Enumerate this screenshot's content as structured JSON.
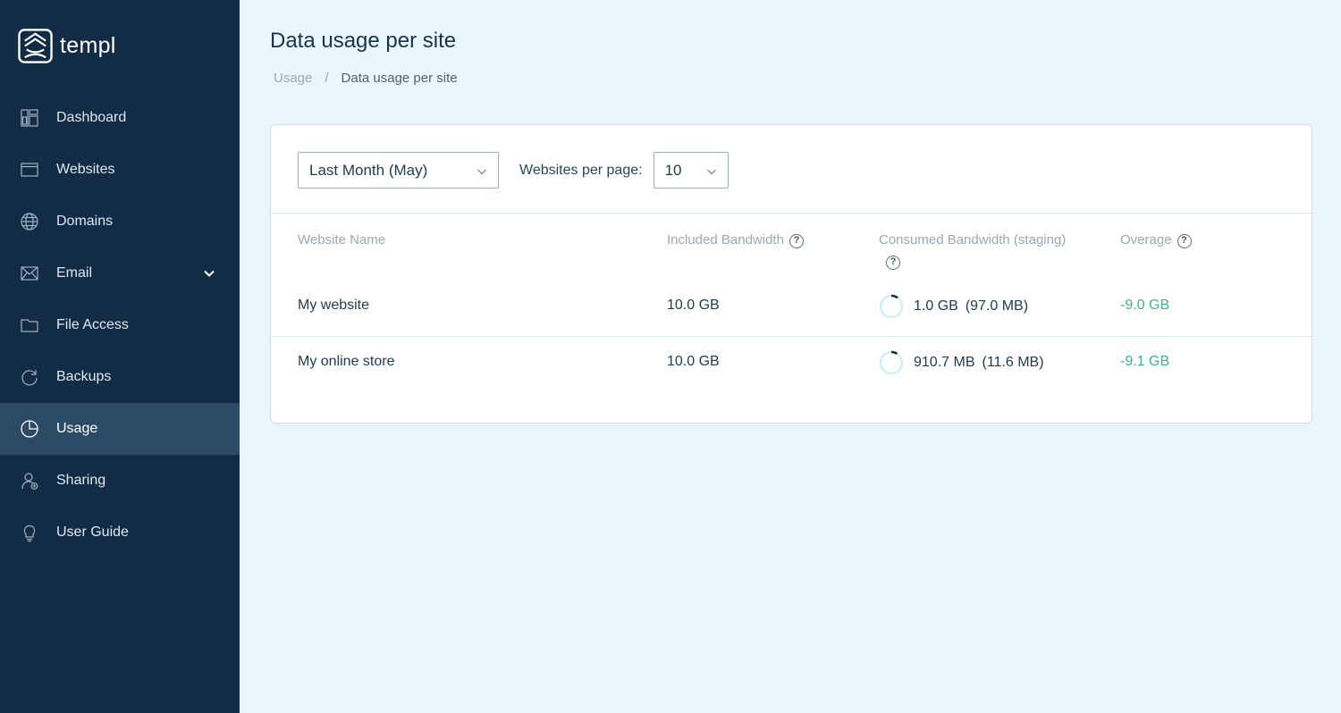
{
  "brand": {
    "name": "templ"
  },
  "sidebar": {
    "items": [
      {
        "label": "Dashboard",
        "icon": "dashboard-icon"
      },
      {
        "label": "Websites",
        "icon": "browser-window-icon"
      },
      {
        "label": "Domains",
        "icon": "globe-icon"
      },
      {
        "label": "Email",
        "icon": "envelope-icon",
        "expandable": true
      },
      {
        "label": "File Access",
        "icon": "folder-icon"
      },
      {
        "label": "Backups",
        "icon": "refresh-icon"
      },
      {
        "label": "Usage",
        "icon": "pie-chart-icon",
        "active": true
      },
      {
        "label": "Sharing",
        "icon": "user-share-icon"
      },
      {
        "label": "User Guide",
        "icon": "lightbulb-icon"
      }
    ]
  },
  "page": {
    "title": "Data usage per site",
    "breadcrumb": {
      "parent": "Usage",
      "separator": "/",
      "current": "Data usage per site"
    }
  },
  "filters": {
    "period": "Last Month (May)",
    "per_page_label": "Websites per page:",
    "per_page": "10"
  },
  "table": {
    "headers": {
      "name": "Website Name",
      "included": "Included Bandwidth",
      "consumed": "Consumed Bandwidth (staging)",
      "overage": "Overage"
    },
    "help_symbol": "?",
    "rows": [
      {
        "name": "My website",
        "included": "10.0 GB",
        "consumed": "1.0 GB",
        "staging": "(97.0 MB)",
        "overage": "-9.0 GB",
        "consumed_fraction": 0.1
      },
      {
        "name": "My online store",
        "included": "10.0 GB",
        "consumed": "910.7 MB",
        "staging": "(11.6 MB)",
        "overage": "-9.1 GB",
        "consumed_fraction": 0.09
      }
    ]
  },
  "colors": {
    "sidebar_bg": "#122c45",
    "sidebar_active": "#2b4a66",
    "page_bg": "#eaf6fb",
    "overage_green": "#3ab68c",
    "ring_track": "#d4ecf5",
    "ring_fill": "#122c45"
  }
}
